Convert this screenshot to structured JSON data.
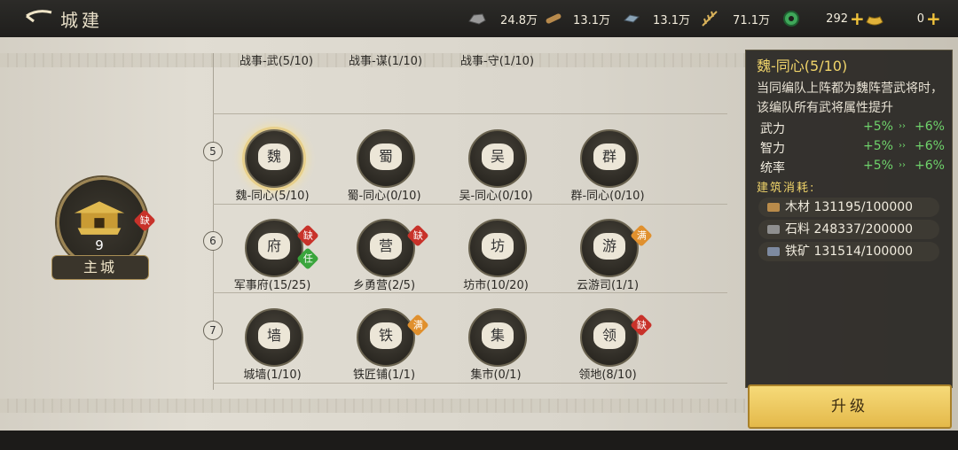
{
  "header": {
    "title": "城建"
  },
  "resources": [
    {
      "icon": "stone-icon",
      "value": "24.8万"
    },
    {
      "icon": "wood-icon",
      "value": "13.1万"
    },
    {
      "icon": "iron-icon",
      "value": "13.1万"
    },
    {
      "icon": "grain-icon",
      "value": "71.1万"
    },
    {
      "icon": "jade-icon",
      "value": "292"
    },
    {
      "icon": "gold-icon",
      "value": "0"
    }
  ],
  "main_city": {
    "level": "9",
    "label": "主城",
    "badge": "缺"
  },
  "rows": {
    "top": [
      {
        "label": "战事-武(5/10)"
      },
      {
        "label": "战事-谋(1/10)"
      },
      {
        "label": "战事-守(1/10)"
      }
    ],
    "r5": {
      "num": "5",
      "nodes": [
        {
          "glyph": "魏",
          "label": "魏-同心(5/10)"
        },
        {
          "glyph": "蜀",
          "label": "蜀-同心(0/10)"
        },
        {
          "glyph": "吴",
          "label": "吴-同心(0/10)"
        },
        {
          "glyph": "群",
          "label": "群-同心(0/10)"
        }
      ]
    },
    "r6": {
      "num": "6",
      "nodes": [
        {
          "glyph": "府",
          "label": "军事府(15/25)",
          "badge1": "缺",
          "badge2": "任"
        },
        {
          "glyph": "营",
          "label": "乡勇营(2/5)",
          "badge1": "缺"
        },
        {
          "glyph": "坊",
          "label": "坊市(10/20)"
        },
        {
          "glyph": "游",
          "label": "云游司(1/1)",
          "badge1": "满"
        }
      ]
    },
    "r7": {
      "num": "7",
      "nodes": [
        {
          "glyph": "墙",
          "label": "城墙(1/10)"
        },
        {
          "glyph": "铁",
          "label": "铁匠铺(1/1)",
          "badge1": "满"
        },
        {
          "glyph": "集",
          "label": "集市(0/1)"
        },
        {
          "glyph": "领",
          "label": "领地(8/10)",
          "badge1": "缺"
        }
      ]
    }
  },
  "panel": {
    "title": "魏-同心(5/10)",
    "description": "当同编队上阵都为魏阵营武将时，该编队所有武将属性提升",
    "stats": [
      {
        "name": "武力",
        "from": "+5%",
        "to": "+6%"
      },
      {
        "name": "智力",
        "from": "+5%",
        "to": "+6%"
      },
      {
        "name": "统率",
        "from": "+5%",
        "to": "+6%"
      }
    ],
    "cost_header": "建筑消耗:",
    "costs": [
      {
        "name": "木材",
        "value": "131195/100000",
        "color": "#b98b4a"
      },
      {
        "name": "石料",
        "value": "248337/200000",
        "color": "#8f8f8f"
      },
      {
        "name": "铁矿",
        "value": "131514/100000",
        "color": "#7d8aa0"
      }
    ]
  },
  "upgrade_button": "升级",
  "colors": {
    "accent": "#f0d46a",
    "button": "#e8c055",
    "green": "#6fd36b"
  }
}
